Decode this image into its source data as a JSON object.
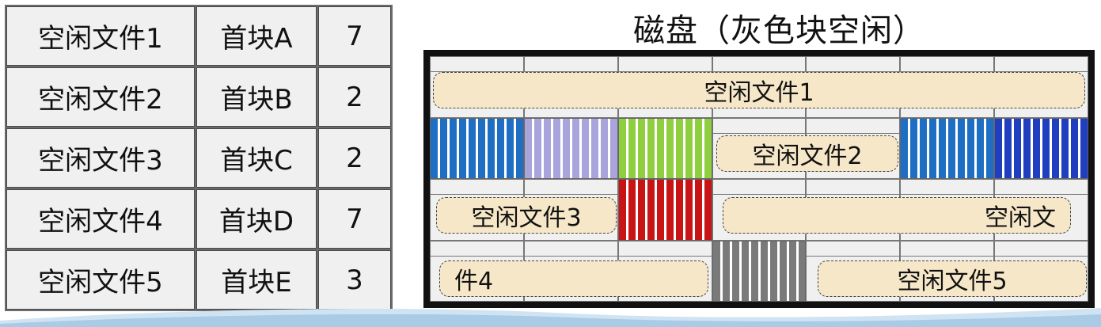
{
  "table": {
    "rows": [
      {
        "name": "空闲文件1",
        "first_block": "首块A",
        "count": "7"
      },
      {
        "name": "空闲文件2",
        "first_block": "首块B",
        "count": "2"
      },
      {
        "name": "空闲文件3",
        "first_block": "首块C",
        "count": "2"
      },
      {
        "name": "空闲文件4",
        "first_block": "首块D",
        "count": "7"
      },
      {
        "name": "空闲文件5",
        "first_block": "首块E",
        "count": "3"
      }
    ]
  },
  "disk": {
    "title": "磁盘（灰色块空闲）",
    "free_labels": {
      "f1": "空闲文件1",
      "f2": "空闲文件2",
      "f3": "空闲文件3",
      "f4a": "空闲文",
      "f4b": "件4",
      "f5": "空闲文件5"
    },
    "colors": {
      "blue": "#1e6fc4",
      "lavender": "#a9a4dc",
      "green": "#8fcf3f",
      "navy": "#1f3fc0",
      "red": "#c81414",
      "gray": "#7a7a7a",
      "free": "#f6e7c8"
    }
  }
}
